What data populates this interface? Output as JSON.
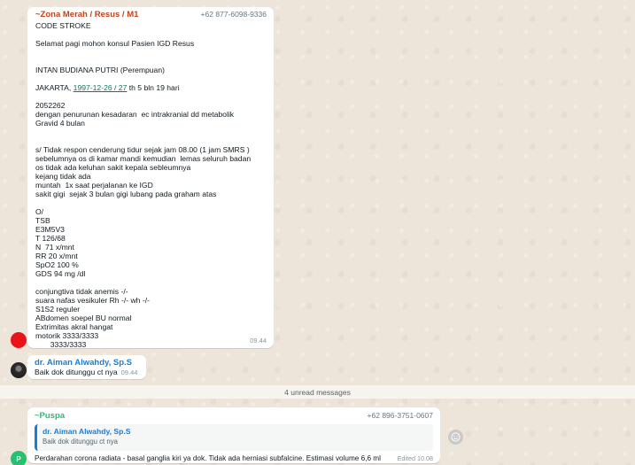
{
  "messages": [
    {
      "sender": "~Zona Merah / Resus / M1",
      "sender_color": "#c0431b",
      "phone": "+62 877-6098-9336",
      "lines_before_date": "CODE STROKE\n\nSelamat pagi mohon konsul Pasien IGD Resus\n\n\nINTAN BUDIANA PUTRI (Perempuan)\n\nJAKARTA, ",
      "date_link": "1997-12-26 / 27",
      "lines_after_date": " th 5 bln 19 hari\n\n2052262\ndengan penurunan kesadaran  ec intrakranial dd metabolik\nGravid 4 bulan\n\n\ns/ Tidak respon cenderung tidur sejak jam 08.00 (1 jam SMRS )\nsebelumnya os di kamar mandi kemudian  lemas seluruh badan\nos tidak ada keluhan sakit kepala sebleumnya\nkejang tidak ada\nmuntah  1x saat perjalanan ke IGD\nsakit gigi  sejak 3 bulan gigi lubang pada graham atas\n\nO/\nTSB\nE3M5V3\nT 126/68\nN  71 x/mnt\nRR 20 x/mnt\nSpO2 100 %\nGDS 94 mg /dl\n\nconjungtiva tidak anemis -/-\nsuara nafas vesikuler Rh -/- wh -/-\nS1S2 reguler\nABdomen soepel BU normal\nExtrimitas akral hangat\nmotorik 3333/3333\n       3333/3333",
      "time": "09.44"
    },
    {
      "sender": "dr. Aiman Alwahdy, Sp.S",
      "sender_color": "#1a7dd4",
      "text": "Baik dok ditunggu ct nya",
      "time": "09.44"
    },
    {
      "sender": "~Puspa",
      "sender_color": "#25c16f",
      "phone": "+62 896-3751-0607",
      "quote_author": "dr. Aiman Alwahdy, Sp.S",
      "quote_text": "Baik dok ditunggu ct nya",
      "text": "Perdarahan  corona radiata - basal ganglia kiri ya dok. Tidak ada herniasi subfalcine. Estimasi volume 6,6 ml",
      "edited_time": "Edited 10.08"
    }
  ],
  "unread_label": "4 unread messages",
  "avatar_p_letter": "P",
  "icons": [
    "avatar-red",
    "avatar-doctor",
    "avatar-p",
    "emoji-reaction-icon"
  ]
}
